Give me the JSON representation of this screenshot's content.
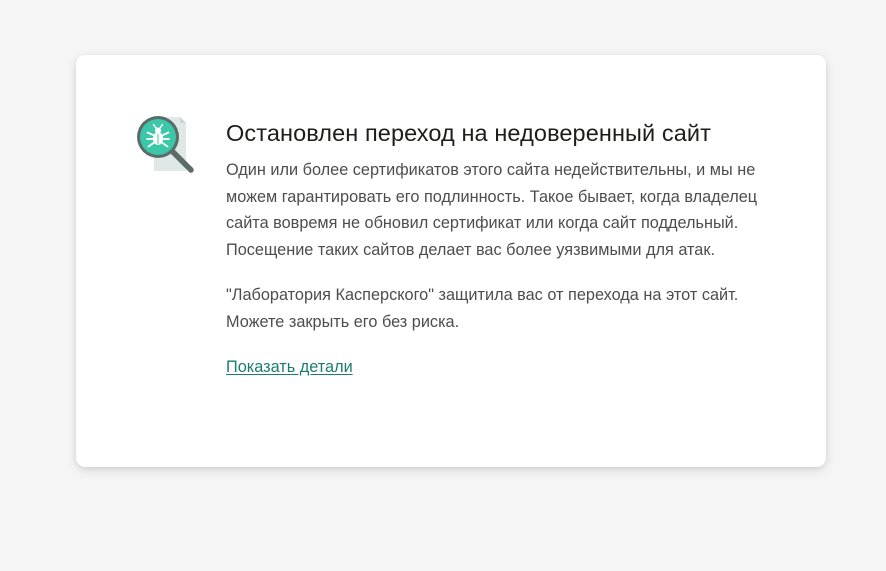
{
  "page": {
    "title": "Остановлен переход на недоверенный сайт",
    "description": "Один или более сертификатов этого сайта недействительны, и мы не можем гарантировать его подлинность. Такое бывает, когда владелец сайта вовремя не обновил сертификат или когда сайт поддельный. Посещение таких сайтов делает вас более уязвимыми для атак.",
    "protection_note": "\"Лаборатория Касперского\" защитила вас от перехода на этот сайт. Можете закрыть его без риска.",
    "details_link": "Показать детали"
  },
  "icon": {
    "name": "bug-magnifier-icon",
    "accent_color": "#3bc7a8",
    "handle_color": "#5a6b69"
  },
  "colors": {
    "background": "#f5f5f5",
    "card": "#ffffff",
    "title": "#1d1d1b",
    "text": "#4d4d4d",
    "link": "#1a7d6b"
  }
}
